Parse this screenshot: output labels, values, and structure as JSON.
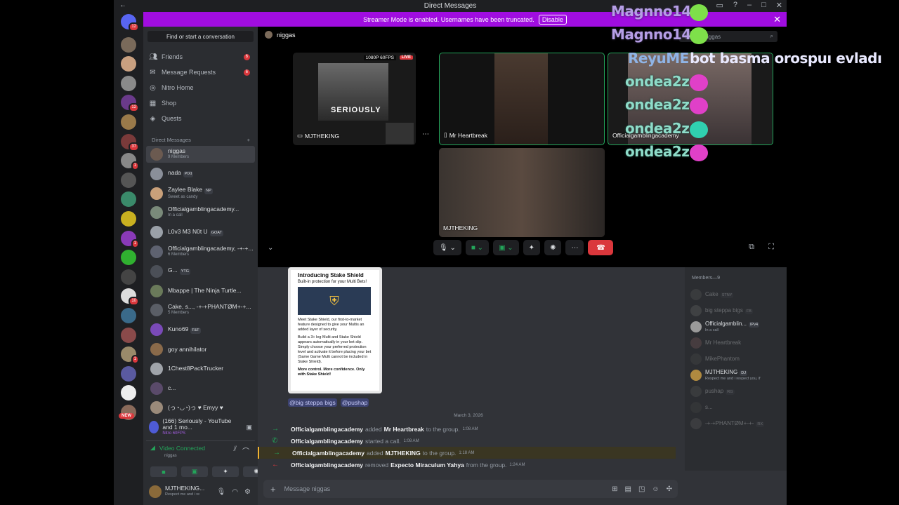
{
  "titlebar": {
    "title": "Direct Messages"
  },
  "banner": {
    "text": "Streamer Mode is enabled. Usernames have been truncated.",
    "button": "Disable"
  },
  "guild_badges": [
    "12",
    "",
    "",
    "",
    "12",
    "",
    "37",
    "1",
    "",
    "",
    "",
    "1",
    "",
    "",
    "10",
    "",
    "",
    "1",
    "",
    "",
    ""
  ],
  "new_badge": "NEW",
  "sidebar": {
    "find": "Find or start a conversation",
    "nav": [
      {
        "label": "Friends",
        "icon": "friends-icon",
        "badge": "6"
      },
      {
        "label": "Message Requests",
        "icon": "mail-icon",
        "badge": "6"
      },
      {
        "label": "Nitro Home",
        "icon": "nitro-icon",
        "badge": ""
      },
      {
        "label": "Shop",
        "icon": "shop-icon",
        "badge": ""
      },
      {
        "label": "Quests",
        "icon": "quests-icon",
        "badge": ""
      }
    ],
    "dm_header": "Direct Messages",
    "dms": [
      {
        "name": "niggas",
        "sub": "9 Members",
        "tag": "",
        "color": "#6b5a50"
      },
      {
        "name": "nada",
        "sub": "",
        "tag": "PIXI",
        "color": "#8a8f99"
      },
      {
        "name": "Zaylee Blake",
        "sub": "Sweet as candy",
        "tag": "NP",
        "color": "#c9a07a"
      },
      {
        "name": "Officialgamblingacademy...",
        "sub": "In a call",
        "tag": "",
        "color": "#7a8a7a"
      },
      {
        "name": "L0v3 M3 N0t U",
        "sub": "",
        "tag": "GOAT",
        "color": "#9aa0a8"
      },
      {
        "name": "Officialgamblingacademy, -+-+...",
        "sub": "6 Members",
        "tag": "",
        "color": "#5e6270"
      },
      {
        "name": "G...",
        "sub": "",
        "tag": "YTG",
        "color": "#4b4f57"
      },
      {
        "name": "Mbappe | The Ninja Turtle...",
        "sub": "",
        "tag": "",
        "color": "#6a7a5a"
      },
      {
        "name": "Cake, s..., -+-+PHANTØM+-+...",
        "sub": "5 Members",
        "tag": "",
        "color": "#5a5e66"
      },
      {
        "name": "Kuno69",
        "sub": "",
        "tag": "F&F",
        "color": "#7a4ab8"
      },
      {
        "name": "goy annihilator",
        "sub": "",
        "tag": "",
        "color": "#8a6a4a"
      },
      {
        "name": "1Chest8PackTrucker",
        "sub": "",
        "tag": "",
        "color": "#a0a4aa"
      },
      {
        "name": "c...",
        "sub": "",
        "tag": "",
        "color": "#5a4a6a"
      },
      {
        "name": "(っ◔◡◔)っ ♥ Emyy ♥",
        "sub": "",
        "tag": "",
        "color": "#9a8a7a"
      }
    ],
    "activity": {
      "title": "(166) Seriously - YouTube and 1 mo...",
      "sub": "Nitro 60FPS"
    },
    "voice": {
      "status": "Video Connected",
      "channel": "niggas"
    },
    "user": {
      "name": "MJTHEKING...",
      "sub": "Respect me and i re"
    }
  },
  "main": {
    "channel": "niggas",
    "search_placeholder": "Search niggas",
    "tiles": [
      {
        "label": "MJTHEKING",
        "live": "LIVE",
        "res": "1080P 60FPS",
        "poster": "SERIOUSLY"
      },
      {
        "label": "Mr Heartbreak"
      },
      {
        "label": "Officialgamblingacademy"
      },
      {
        "label": "MJTHEKING"
      }
    ],
    "card": {
      "title": "Introducing Stake Shield",
      "sub": "Built-in protection for your Multi Bets!",
      "p1": "Meet Stake Shield, our first-to-market feature designed to give your Multis an added layer of security.",
      "p2": "Build a 3+ leg Multi and Stake Shield appears automatically in your bet slip. Simply choose your preferred protection level and activate it before placing your bet (Same Game Multi cannot be included in Stake Shield).",
      "p3": "More control. More confidence. Only with Stake Shield!"
    },
    "mentions": [
      "@big steppa bigs",
      "@pushap"
    ],
    "date": "March 3, 2026",
    "system": [
      {
        "actor": "Officialgamblingacademy",
        "verb": "added",
        "target": "Mr Heartbreak",
        "tail": "to the group.",
        "time": "1:08 AM",
        "arrow": "→",
        "color": "#23a55a"
      },
      {
        "actor": "Officialgamblingacademy",
        "verb": "started a call.",
        "target": "",
        "tail": "",
        "time": "1:08 AM",
        "arrow": "✆",
        "color": "#23a55a"
      },
      {
        "actor": "Officialgamblingacademy",
        "verb": "added",
        "target": "MJTHEKING",
        "tail": "to the group.",
        "time": "1:18 AM",
        "arrow": "→",
        "color": "#23a55a"
      },
      {
        "actor": "Officialgamblingacademy",
        "verb": "removed",
        "target": "Expecto Miraculum Yahya",
        "tail": "from the group.",
        "time": "1:24 AM",
        "arrow": "←",
        "color": "#da373c"
      }
    ],
    "composer_placeholder": "Message niggas"
  },
  "members": {
    "header": "Members—9",
    "list": [
      {
        "name": "Cake",
        "sub": "",
        "tag": "STNY",
        "dim": true
      },
      {
        "name": "big steppa bigs",
        "sub": "",
        "tag": "FB",
        "dim": true
      },
      {
        "name": "Officialgamblin...",
        "sub": "In a call",
        "tag": "IPv4",
        "dim": false
      },
      {
        "name": "Mr Heartbreak",
        "sub": "",
        "tag": "",
        "dim": true
      },
      {
        "name": "MikePhantom",
        "sub": "",
        "tag": "",
        "dim": true
      },
      {
        "name": "MJTHEKING",
        "sub": "Respect me and i respect you, if",
        "tag": "DJ",
        "dim": false
      },
      {
        "name": "pushap",
        "sub": "",
        "tag": "RG",
        "dim": true
      },
      {
        "name": "s...",
        "sub": "",
        "tag": "",
        "dim": true
      },
      {
        "name": "-+-+PHANTØM+-+-",
        "sub": "",
        "tag": "RX",
        "dim": true
      }
    ]
  },
  "overlay": {
    "lines": [
      {
        "name": "Magnno14",
        "text": "",
        "cls": "n1"
      },
      {
        "name": "Magnno14",
        "text": "",
        "cls": "n1"
      },
      {
        "name": "ReyuME",
        "text": "bot basma orospuı evladı",
        "cls": "n3"
      },
      {
        "name": "ondea2z",
        "text": "",
        "cls": "n2"
      },
      {
        "name": "ondea2z",
        "text": "",
        "cls": "n2"
      },
      {
        "name": "ondea2z",
        "text": "",
        "cls": "n2"
      },
      {
        "name": "ondea2z",
        "text": "",
        "cls": "n2"
      }
    ]
  }
}
